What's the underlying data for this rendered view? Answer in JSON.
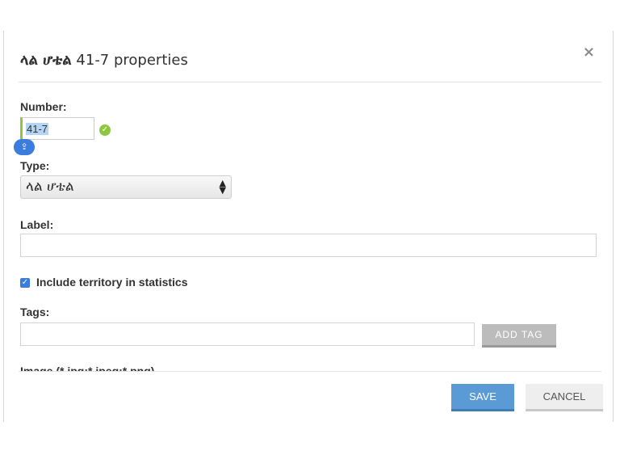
{
  "dialog": {
    "title_name": "ላል ሆቴል",
    "title_suffix": " 41-7 properties",
    "close_glyph": "×"
  },
  "form": {
    "number": {
      "label": "Number:",
      "value": "41-7",
      "status_icon": "check-circle-icon",
      "keyboard_icon": "shift-icon"
    },
    "type": {
      "label": "Type:",
      "selected": "ላል ሆቴል"
    },
    "label_field": {
      "label": "Label:",
      "value": ""
    },
    "include_statistics": {
      "label": "Include territory in statistics",
      "checked": true
    },
    "tags": {
      "label": "Tags:",
      "value": "",
      "add_button": "ADD TAG"
    },
    "image": {
      "label": "Image (*.jpg;*.jpeg;*.png)"
    }
  },
  "footer": {
    "save_label": "SAVE",
    "cancel_label": "CANCEL"
  },
  "colors": {
    "accent_blue": "#5b9bd5",
    "valid_green": "#8dc63f",
    "checkbox_blue": "#3b7ddd"
  }
}
